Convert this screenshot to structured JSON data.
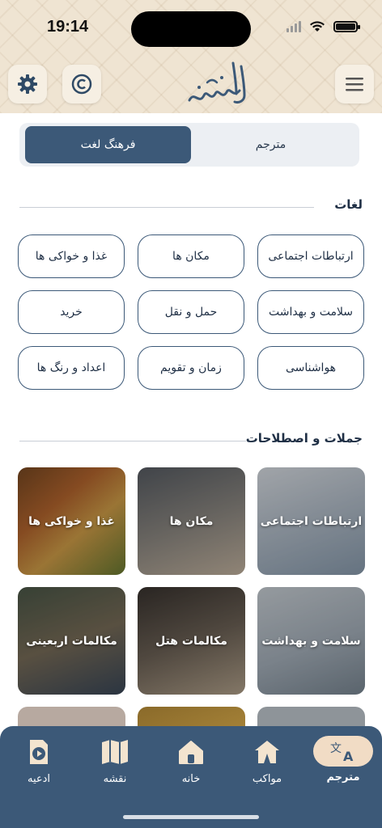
{
  "status": {
    "time": "19:14"
  },
  "header": {
    "logo_alt": "طريق الحسين",
    "settings_icon": "gear-icon",
    "copyright_icon": "copyright-icon",
    "menu_icon": "hamburger-icon"
  },
  "segment": {
    "active_label": "فرهنگ لغت",
    "inactive_label": "مترجم"
  },
  "sections": {
    "words_title": "لغات",
    "phrases_title": "جملات و اصطلاحات"
  },
  "words": [
    "ارتباطات اجتماعی",
    "مکان ها",
    "غذا و خواکی ها",
    "سلامت و بهداشت",
    "حمل و نقل",
    "خرید",
    "هواشناسی",
    "زمان و تقویم",
    "اعداد و رنگ ها"
  ],
  "phrases": [
    "ارتباطات اجتماعی",
    "مکان ها",
    "غذا و خواکی ها",
    "سلامت و بهداشت",
    "مکالمات هتل",
    "مکالمات اربعینی"
  ],
  "nav": {
    "items": [
      "مترجم",
      "مواکب",
      "خانه",
      "نقشه",
      "ادعیه"
    ],
    "active": "مترجم"
  },
  "colors": {
    "primary": "#3c5978",
    "header_bg": "#efe4d2",
    "active_pill": "#f1dcc5"
  }
}
